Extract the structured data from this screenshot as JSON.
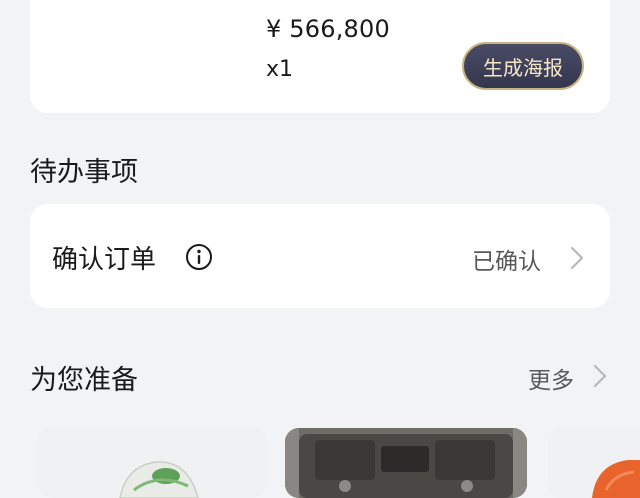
{
  "order": {
    "price": "¥ 566,800",
    "quantity": "x1",
    "poster_button_label": "生成海报"
  },
  "todo": {
    "section_title": "待办事项",
    "item_label": "确认订单",
    "item_status": "已确认"
  },
  "recommend": {
    "section_title": "为您准备",
    "more_label": "更多"
  },
  "colors": {
    "page_bg": "#f2f3f5",
    "card_bg": "#ffffff",
    "poster_button_bg": "#3e4058",
    "poster_button_border": "#c9b383",
    "poster_button_text": "#f6e7c8",
    "secondary_text": "#595959"
  },
  "icons": {
    "info": "info-circle-icon",
    "chevron": "chevron-right-icon"
  }
}
